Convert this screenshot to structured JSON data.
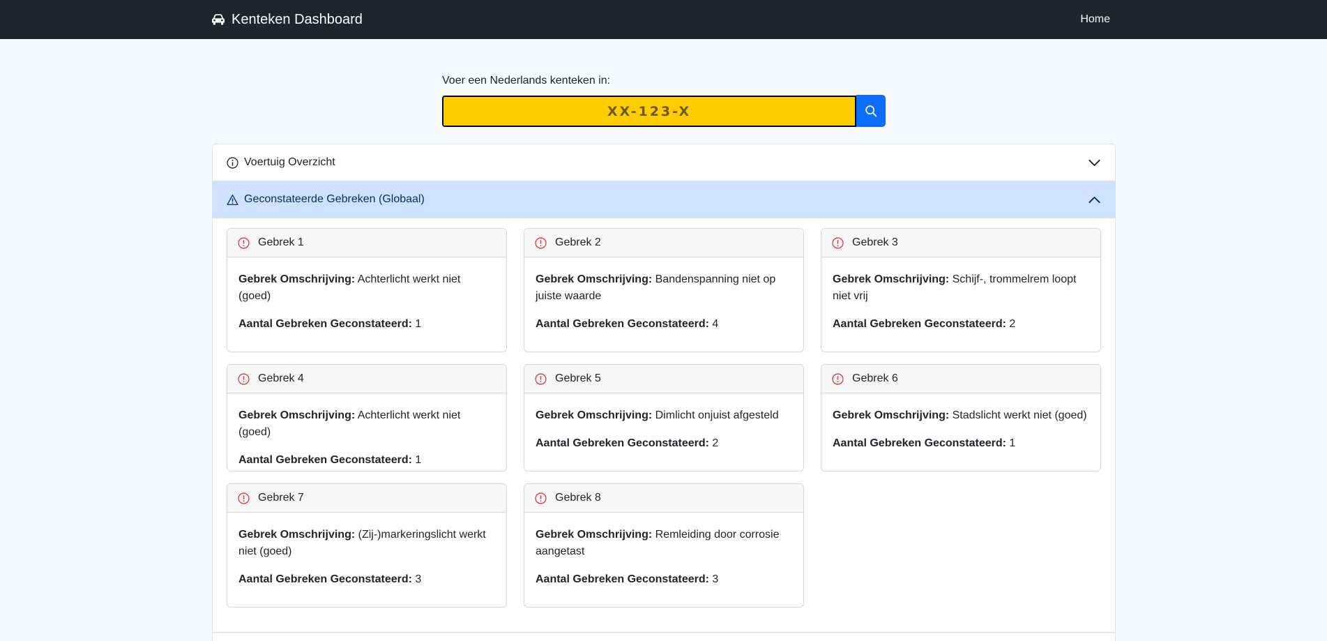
{
  "navbar": {
    "brand": "Kenteken Dashboard",
    "brand_icon": "car-icon",
    "home_label": "Home"
  },
  "search": {
    "label": "Voer een Nederlands kenteken in:",
    "placeholder": "XX-123-X",
    "button_icon": "search-icon",
    "plate_color": "#ffcc00",
    "button_color": "#0d6efd"
  },
  "accordion": {
    "overview_title": "Voertuig Overzicht",
    "defects_title": "Geconstateerde Gebreken (Globaal)"
  },
  "labels": {
    "description": "Gebrek Omschrijving:",
    "count": "Aantal Gebreken Geconstateerd:"
  },
  "defects": [
    {
      "title": "Gebrek 1",
      "description": "Achterlicht werkt niet (goed)",
      "count": "1"
    },
    {
      "title": "Gebrek 2",
      "description": "Bandenspanning niet op juiste waarde",
      "count": "4"
    },
    {
      "title": "Gebrek 3",
      "description": "Schijf-, trommelrem loopt niet vrij",
      "count": "2"
    },
    {
      "title": "Gebrek 4",
      "description": "Achterlicht werkt niet (goed)",
      "count": "1"
    },
    {
      "title": "Gebrek 5",
      "description": "Dimlicht onjuist afgesteld",
      "count": "2"
    },
    {
      "title": "Gebrek 6",
      "description": "Stadslicht werkt niet (goed)",
      "count": "1"
    },
    {
      "title": "Gebrek 7",
      "description": "(Zij-)markeringslicht werkt niet (goed)",
      "count": "3"
    },
    {
      "title": "Gebrek 8",
      "description": "Remleiding door corrosie aangetast",
      "count": "3"
    }
  ]
}
